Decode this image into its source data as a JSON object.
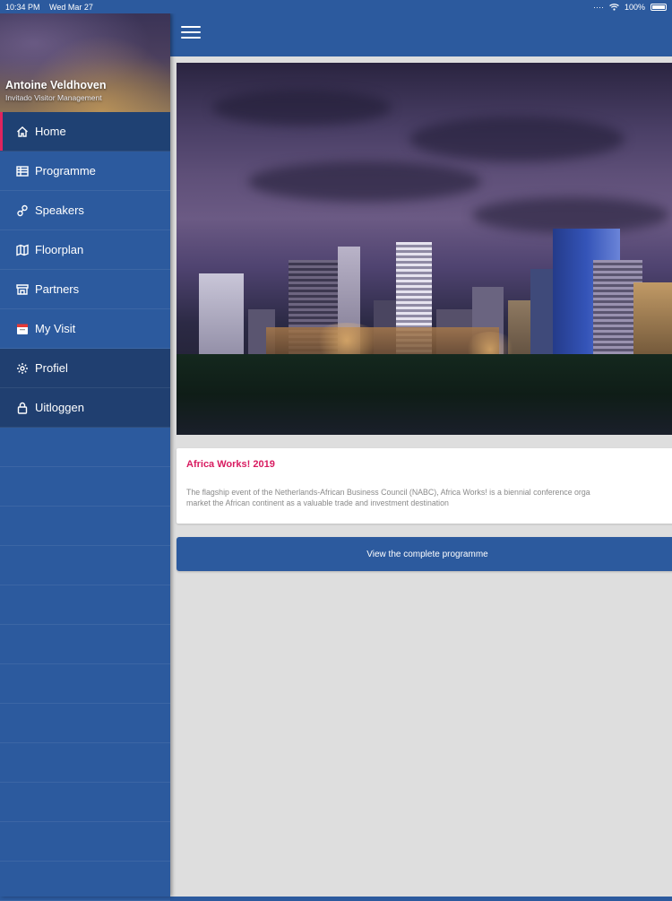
{
  "status_bar": {
    "time": "10:34 PM",
    "date": "Wed Mar 27",
    "battery": "100%"
  },
  "profile": {
    "name": "Antoine Veldhoven",
    "organization": "Invitado Visitor Management"
  },
  "menu": [
    {
      "label": "Home",
      "icon": "home-icon"
    },
    {
      "label": "Programme",
      "icon": "table-icon"
    },
    {
      "label": "Speakers",
      "icon": "link-icon"
    },
    {
      "label": "Floorplan",
      "icon": "map-icon"
    },
    {
      "label": "Partners",
      "icon": "storefront-icon"
    },
    {
      "label": "My Visit",
      "icon": "calendar-icon"
    },
    {
      "label": "Profiel",
      "icon": "gear-icon"
    },
    {
      "label": "Uitloggen",
      "icon": "lock-icon"
    }
  ],
  "event": {
    "title": "Africa Works! 2019",
    "description_line1": "The flagship event of the Netherlands-African Business Council (NABC), Africa Works! is a biennial conference orga",
    "description_line2": "market the African continent as a valuable trade and investment destination"
  },
  "cta": {
    "label": "View the complete programme"
  },
  "colors": {
    "primary": "#2c5a9e",
    "active_item": "#1f4173",
    "accent": "#e0245e",
    "title_pink": "#d81b60",
    "background": "#dedede"
  }
}
